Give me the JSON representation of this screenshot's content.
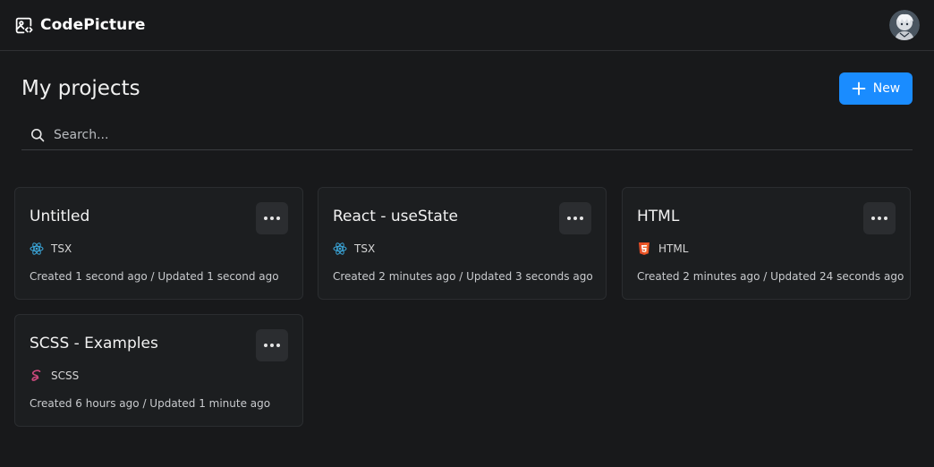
{
  "app": {
    "name": "CodePicture"
  },
  "header": {
    "title": "My projects",
    "new_label": "New"
  },
  "search": {
    "placeholder": "Search..."
  },
  "projects": [
    {
      "title": "Untitled",
      "language": "TSX",
      "language_icon": "react-icon",
      "created": "Created 1 second ago",
      "updated": "Updated 1 second ago",
      "separator": " / "
    },
    {
      "title": "React - useState",
      "language": "TSX",
      "language_icon": "react-icon",
      "created": "Created 2 minutes ago",
      "updated": "Updated 3 seconds ago",
      "separator": " / "
    },
    {
      "title": "HTML",
      "language": "HTML",
      "language_icon": "html5-icon",
      "created": "Created 2 minutes ago",
      "updated": "Updated 24 seconds ago",
      "separator": " / "
    },
    {
      "title": "SCSS - Examples",
      "language": "SCSS",
      "language_icon": "sass-icon",
      "created": "Created 6 hours ago",
      "updated": "Updated 1 minute ago",
      "separator": " / "
    }
  ],
  "colors": {
    "background": "#18191b",
    "card": "#1c1e20",
    "accent": "#1a8cff",
    "react": "#3ba6d9",
    "html5": "#e44d26",
    "sass": "#cd4a7d"
  }
}
